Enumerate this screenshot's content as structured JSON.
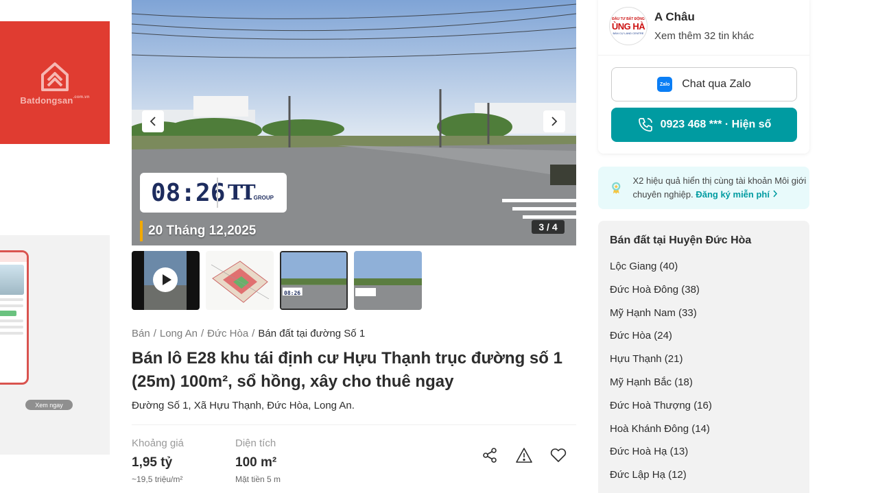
{
  "ad": {
    "brand": "Batdongsan",
    "brand_suffix": ".com.vn",
    "cta": "Xem ngay"
  },
  "gallery": {
    "time": "08:26",
    "stamp_logo": "TT",
    "stamp_logo_sub": "GROUP",
    "date": "20 Tháng 12,2025",
    "counter": "3 / 4",
    "thumb_time": "08:26"
  },
  "breadcrumb": {
    "items": [
      "Bán",
      "Long An",
      "Đức Hòa"
    ],
    "current": "Bán đất tại đường Số 1"
  },
  "listing": {
    "title": "Bán lô E28 khu tái định cư Hựu Thạnh trục đường số 1 (25m) 100m², sổ hồng, xây cho thuê ngay",
    "address": "Đường Số 1, Xã Hựu Thạnh, Đức Hòa, Long An.",
    "price_label": "Khoảng giá",
    "price_value": "1,95 tỷ",
    "price_sub": "~19,5 triệu/m²",
    "area_label": "Diện tích",
    "area_value": "100 m²",
    "area_sub": "Mặt tiền 5 m"
  },
  "agent": {
    "name": "A Châu",
    "more": "Xem thêm 32 tin khác",
    "avatar_text": "ÙNG HÀ",
    "zalo_label": "Chat qua Zalo",
    "zalo_icon_text": "Zalo",
    "phone_label": "0923 468 *** · Hiện số"
  },
  "promo": {
    "text": "X2 hiệu quả hiển thị cùng tài khoản Môi giới chuyên nghiệp.",
    "link": "Đăng ký miễn phí"
  },
  "areas": {
    "title": "Bán đất tại Huyện Đức Hòa",
    "items": [
      "Lộc Giang (40)",
      "Đức Hoà Đông (38)",
      "Mỹ Hạnh Nam (33)",
      "Đức Hòa (24)",
      "Hựu Thạnh (21)",
      "Mỹ Hạnh Bắc (18)",
      "Đức Hoà Thượng (16)",
      "Hoà Khánh Đông (14)",
      "Đức Hoà Hạ (13)",
      "Đức Lập Hạ (12)"
    ]
  },
  "icons": {
    "share": "share-icon",
    "report": "warning-icon",
    "save": "heart-icon",
    "phone": "phone-icon",
    "zalo": "zalo-icon"
  },
  "colors": {
    "brand_red": "#e03c31",
    "teal": "#009ba1"
  }
}
